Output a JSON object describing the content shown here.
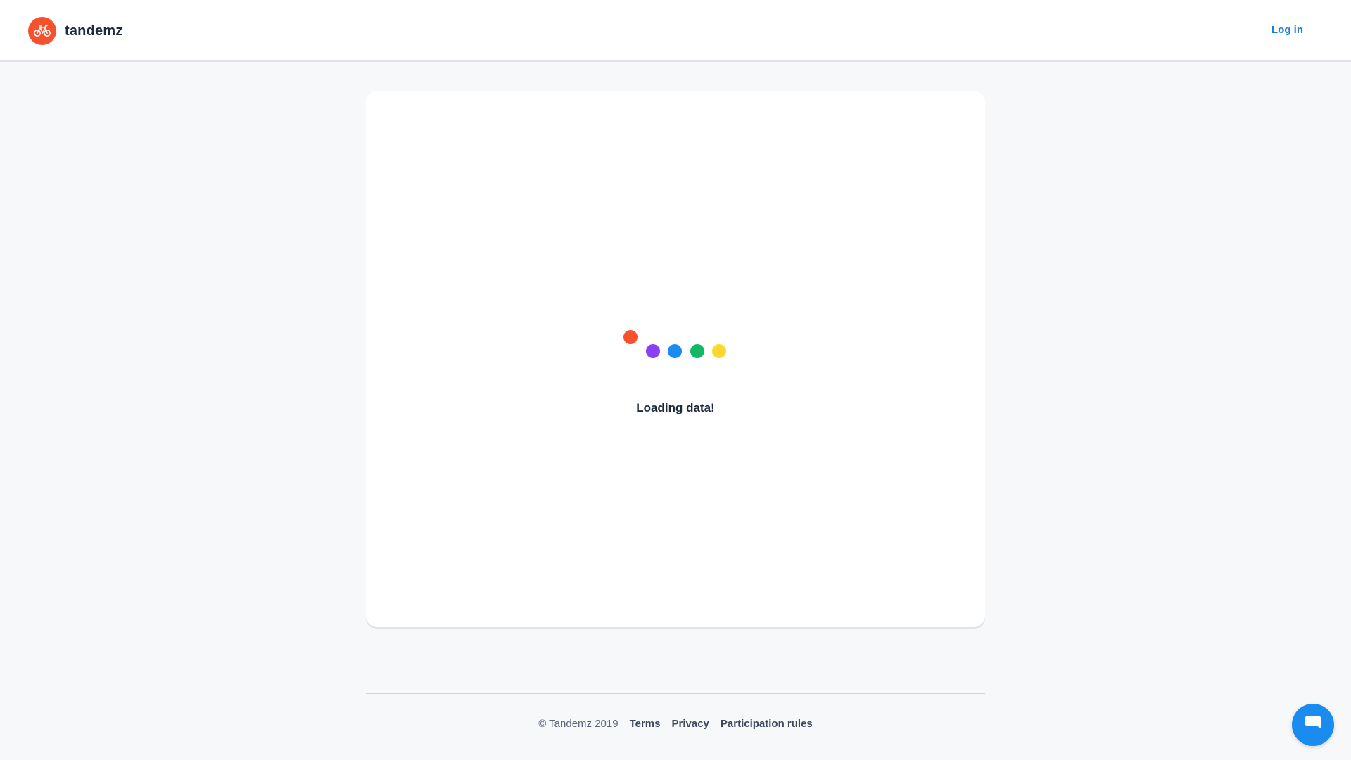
{
  "colors": {
    "brand": "#f4512c",
    "link": "#1f7ed6",
    "chat": "#1a8cf0",
    "dot_red": "#f4512c",
    "dot_purple": "#8a3ff0",
    "dot_blue": "#1a8cf0",
    "dot_green": "#12b864",
    "dot_yellow": "#fbd82f"
  },
  "header": {
    "logo_icon": "bicycle-icon",
    "brand_name": "tandemz",
    "login_label": "Log in"
  },
  "main": {
    "loading_text": "Loading data!"
  },
  "footer": {
    "copyright": "© Tandemz 2019",
    "links": [
      "Terms",
      "Privacy",
      "Participation rules"
    ]
  },
  "chat": {
    "icon": "chat-bubble-icon"
  }
}
